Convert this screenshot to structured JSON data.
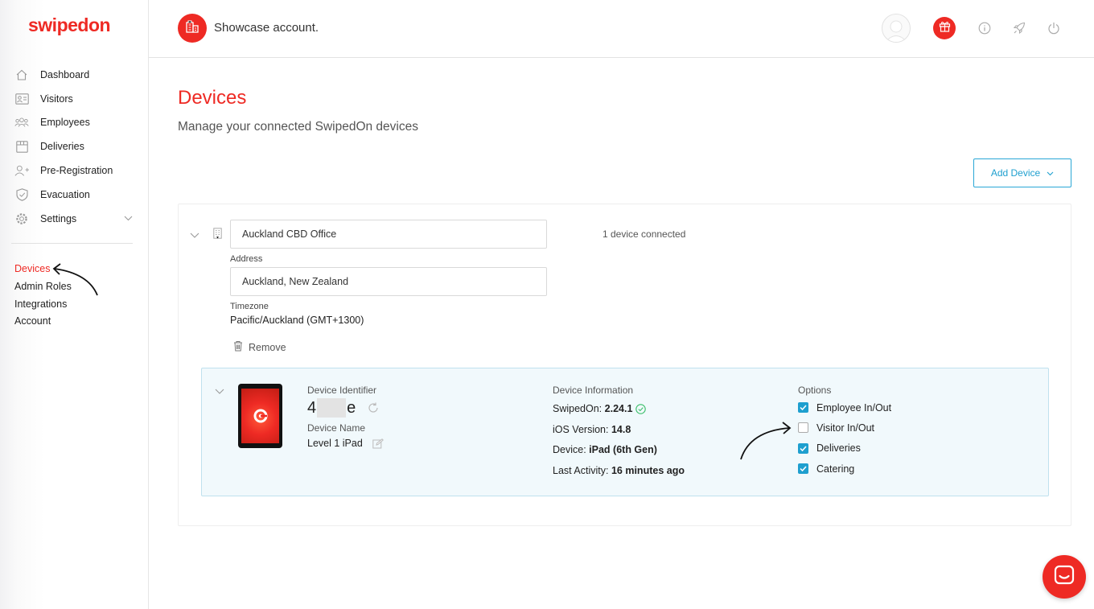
{
  "brand": {
    "logo_text": "swipedon",
    "accent": "#ee2a24",
    "link": "#1e9fcf"
  },
  "header": {
    "account_name": "Showcase account."
  },
  "sidebar": {
    "items": [
      {
        "label": "Dashboard",
        "icon": "home-icon"
      },
      {
        "label": "Visitors",
        "icon": "visitor-card-icon"
      },
      {
        "label": "Employees",
        "icon": "employees-icon"
      },
      {
        "label": "Deliveries",
        "icon": "box-icon"
      },
      {
        "label": "Pre-Registration",
        "icon": "add-user-icon"
      },
      {
        "label": "Evacuation",
        "icon": "shield-icon"
      },
      {
        "label": "Settings",
        "icon": "gear-icon"
      }
    ],
    "secondary": [
      {
        "label": "Devices",
        "active": true
      },
      {
        "label": "Admin Roles"
      },
      {
        "label": "Integrations"
      },
      {
        "label": "Account"
      }
    ]
  },
  "main": {
    "title": "Devices",
    "subtitle": "Manage your connected SwipedOn devices",
    "add_device_label": "Add Device",
    "location": {
      "name": "Auckland CBD Office",
      "address_label": "Address",
      "address": "Auckland, New Zealand",
      "timezone_label": "Timezone",
      "timezone": "Pacific/Auckland (GMT+1300)",
      "remove_label": "Remove",
      "connected": "1 device connected"
    },
    "device": {
      "identifier_label": "Device Identifier",
      "identifier_start": "4",
      "identifier_end": "e",
      "name_label": "Device Name",
      "name": "Level 1 iPad",
      "info_label": "Device Information",
      "swipedon_label": "SwipedOn:",
      "swipedon_version": "2.24.1",
      "ios_label": "iOS Version:",
      "ios_version": "14.8",
      "device_label": "Device:",
      "device_model": "iPad (6th Gen)",
      "activity_label": "Last Activity:",
      "activity": "16 minutes ago",
      "options_label": "Options",
      "options": [
        {
          "label": "Employee In/Out",
          "checked": true
        },
        {
          "label": "Visitor In/Out",
          "checked": false
        },
        {
          "label": "Deliveries",
          "checked": true
        },
        {
          "label": "Catering",
          "checked": true
        }
      ]
    }
  }
}
